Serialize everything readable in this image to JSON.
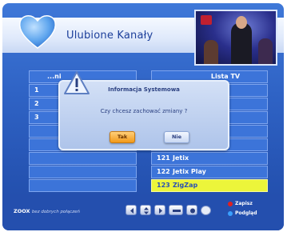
{
  "header": {
    "title": "Ulubione Kanały"
  },
  "left_list": {
    "partial_header": "...ni",
    "rows": [
      {
        "number": "",
        "name": ""
      },
      {
        "number": "1",
        "name": ""
      },
      {
        "number": "2",
        "name": ""
      },
      {
        "number": "3",
        "name": ""
      },
      {
        "number": "",
        "name": ""
      },
      {
        "number": "",
        "name": ""
      },
      {
        "number": "",
        "name": ""
      },
      {
        "number": "",
        "name": ""
      },
      {
        "number": "",
        "name": ""
      }
    ]
  },
  "right_list": {
    "rows": [
      {
        "number": "",
        "name": "Lista TV"
      },
      {
        "number": "",
        "name": ""
      },
      {
        "number": "",
        "name": ""
      },
      {
        "number": "",
        "name": ""
      },
      {
        "number": "",
        "name": ""
      },
      {
        "number": "",
        "name": ""
      },
      {
        "number": "121",
        "name": "Jetix"
      },
      {
        "number": "122",
        "name": "Jetix Play"
      },
      {
        "number": "123",
        "name": "ZigZap",
        "selected": true
      }
    ]
  },
  "dialog": {
    "title": "Informacja Systemowa",
    "message": "Czy chcesz zachować zmiany ?",
    "yes_label": "Tak",
    "no_label": "Nie"
  },
  "footer": {
    "brand": "ZOOX",
    "brand_sub": "bez dobrych połączeń",
    "actions": [
      {
        "label": "Zapisz",
        "color": "#e02020"
      },
      {
        "label": "Podgląd",
        "color": "#3aa0ff"
      }
    ],
    "keys": [
      "left-arrow-key",
      "up-down-key",
      "right-arrow-key",
      "back-key",
      "ok-key"
    ]
  },
  "colors": {
    "background": "#2f63c5",
    "highlight": "#ecf53a",
    "dialog": "#c6d6f2",
    "yes_button": "#f29a1a"
  }
}
